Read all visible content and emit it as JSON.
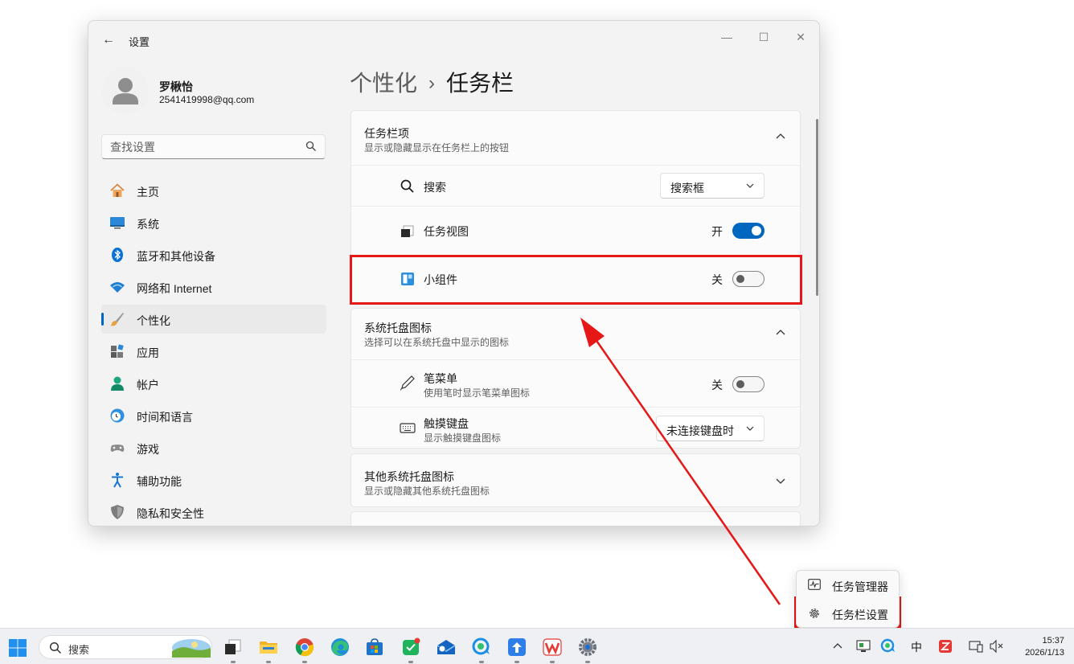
{
  "window": {
    "app_title": "设置",
    "back": "←",
    "minimize": "—",
    "maximize": "☐",
    "close": "✕"
  },
  "user": {
    "name": "罗楸怡",
    "email": "2541419998@qq.com"
  },
  "search": {
    "placeholder": "查找设置"
  },
  "sidebar": {
    "items": [
      {
        "label": "主页",
        "icon": "home-icon"
      },
      {
        "label": "系统",
        "icon": "system-icon"
      },
      {
        "label": "蓝牙和其他设备",
        "icon": "bluetooth-icon"
      },
      {
        "label": "网络和 Internet",
        "icon": "wifi-icon"
      },
      {
        "label": "个性化",
        "icon": "brush-icon",
        "active": true
      },
      {
        "label": "应用",
        "icon": "apps-icon"
      },
      {
        "label": "帐户",
        "icon": "account-icon"
      },
      {
        "label": "时间和语言",
        "icon": "clock-globe-icon"
      },
      {
        "label": "游戏",
        "icon": "gamepad-icon"
      },
      {
        "label": "辅助功能",
        "icon": "accessibility-icon"
      },
      {
        "label": "隐私和安全性",
        "icon": "shield-icon"
      }
    ]
  },
  "breadcrumb": {
    "parent": "个性化",
    "separator": "›",
    "current": "任务栏"
  },
  "taskbar_items": {
    "title": "任务栏项",
    "subtitle": "显示或隐藏显示在任务栏上的按钮",
    "rows": [
      {
        "label": "搜索",
        "control": "dropdown",
        "value": "搜索框"
      },
      {
        "label": "任务视图",
        "control": "toggle",
        "state_text": "开",
        "on": true
      },
      {
        "label": "小组件",
        "control": "toggle",
        "state_text": "关",
        "on": false
      }
    ]
  },
  "tray_icons": {
    "title": "系统托盘图标",
    "subtitle": "选择可以在系统托盘中显示的图标",
    "rows": [
      {
        "label": "笔菜单",
        "sub": "使用笔时显示笔菜单图标",
        "control": "toggle",
        "state_text": "关",
        "on": false
      },
      {
        "label": "触摸键盘",
        "sub": "显示触摸键盘图标",
        "control": "dropdown",
        "value": "未连接键盘时"
      }
    ]
  },
  "other_tray": {
    "title": "其他系统托盘图标",
    "subtitle": "显示或隐藏其他系统托盘图标"
  },
  "context_menu": {
    "items": [
      {
        "label": "任务管理器",
        "icon": "task-manager-icon"
      },
      {
        "label": "任务栏设置",
        "icon": "gear-icon"
      }
    ]
  },
  "taskbar": {
    "search_label": "搜索",
    "ime": "中",
    "time": "15:37",
    "date": "2026/1/13"
  },
  "colors": {
    "accent": "#0067c0",
    "annotation": "#e61717"
  }
}
